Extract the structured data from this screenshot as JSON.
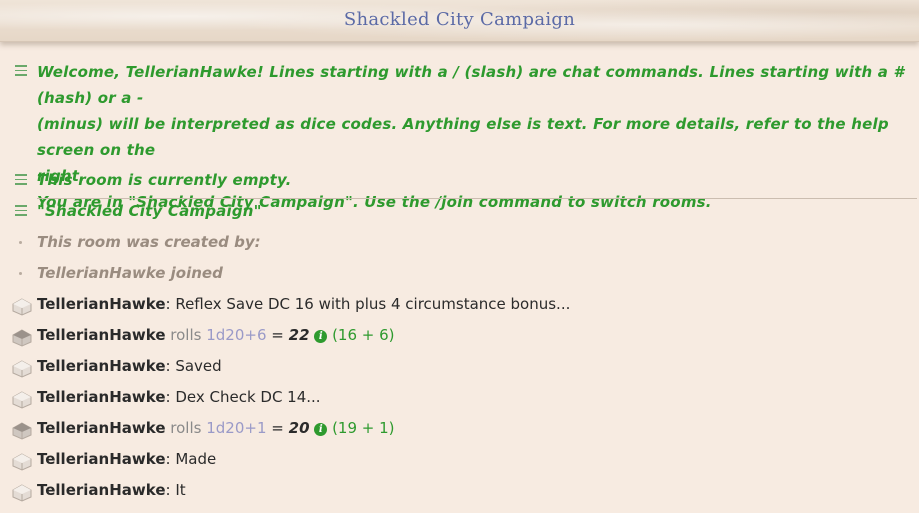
{
  "header": {
    "title": "Shackled City Campaign"
  },
  "welcome": {
    "line1": "Welcome, TellerianHawke! Lines starting with a / (slash) are chat commands. Lines starting with a # (hash) or a -",
    "line2": "(minus) will be interpreted as dice codes. Anything else is text. For more details, refer to the help screen on the",
    "line3": "right.",
    "line4": "You are in \"Shackled City Campaign\". Use the /join command to switch rooms."
  },
  "room_status": "This room is currently empty.",
  "room_name": "\"Shackled City Campaign\"",
  "room_created": "This room was created by:",
  "joined": "TellerianHawke joined",
  "messages": [
    {
      "who": "TellerianHawke",
      "text": ": Reflex Save DC 16 with plus 4 circumstance bonus..."
    },
    {
      "who": "TellerianHawke",
      "rolls": "rolls",
      "dice": "1d20+6",
      "eq": "=",
      "total": "22",
      "info": "i",
      "detail": "(16 + 6)"
    },
    {
      "who": "TellerianHawke",
      "text": ": Saved"
    },
    {
      "who": "TellerianHawke",
      "text": ": Dex Check DC 14..."
    },
    {
      "who": "TellerianHawke",
      "rolls": "rolls",
      "dice": "1d20+1",
      "eq": "=",
      "total": "20",
      "info": "i",
      "detail": "(19 + 1)"
    },
    {
      "who": "TellerianHawke",
      "text": ": Made"
    },
    {
      "who": "TellerianHawke",
      "text": ": It"
    }
  ],
  "colors": {
    "system_green": "#2e9a2e",
    "title_blue": "#5b6aa6",
    "dice_purple": "#9a9ac8"
  }
}
